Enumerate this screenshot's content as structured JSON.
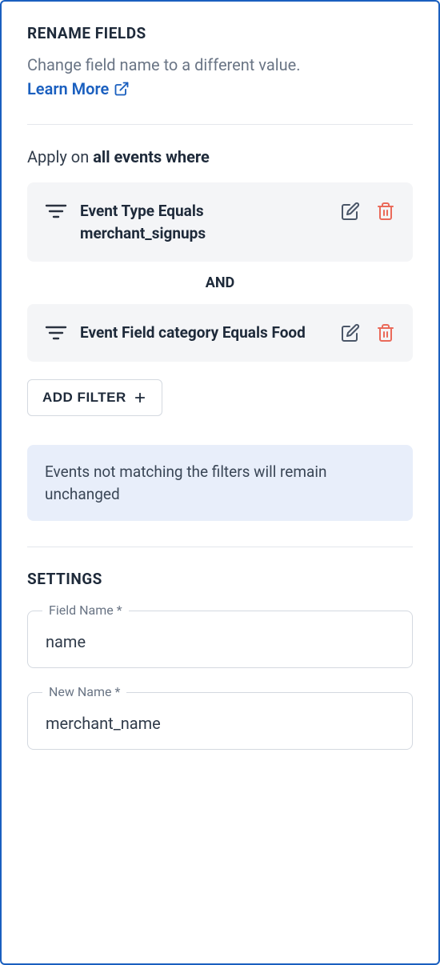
{
  "header": {
    "title": "RENAME FIELDS",
    "description": "Change field name to a different value.",
    "learn_more_label": "Learn More"
  },
  "filters": {
    "apply_on_prefix": "Apply on ",
    "apply_on_bold": "all events where",
    "items": [
      {
        "text": "Event Type Equals merchant_signups"
      },
      {
        "text": "Event Field category Equals Food"
      }
    ],
    "connector": "AND",
    "add_filter_label": "ADD FILTER",
    "info_text": "Events not matching the filters will remain unchanged"
  },
  "settings": {
    "title": "SETTINGS",
    "field_name_label": "Field Name *",
    "field_name_value": "name",
    "new_name_label": "New Name *",
    "new_name_value": "merchant_name"
  }
}
